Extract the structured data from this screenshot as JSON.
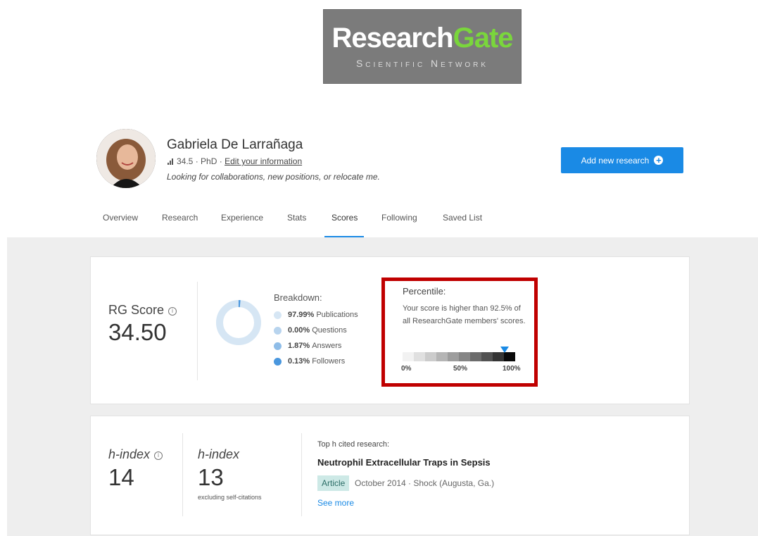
{
  "logo": {
    "word1": "Research",
    "word2": "Gate",
    "subtitle": "Scientific Network"
  },
  "profile": {
    "name": "Gabriela De Larrañaga",
    "score": "34.5",
    "degree": "· PhD ·",
    "edit_link": "Edit your information",
    "tagline": "Looking for collaborations, new positions, or relocate me."
  },
  "actions": {
    "add_research": "Add new research"
  },
  "tabs": [
    {
      "label": "Overview"
    },
    {
      "label": "Research"
    },
    {
      "label": "Experience"
    },
    {
      "label": "Stats"
    },
    {
      "label": "Scores",
      "active": true
    },
    {
      "label": "Following"
    },
    {
      "label": "Saved List"
    }
  ],
  "rg_score": {
    "label": "RG Score",
    "value": "34.50",
    "breakdown_label": "Breakdown:",
    "breakdown": [
      {
        "pct": "97.99%",
        "label": "Publications",
        "color": "#d6e6f4"
      },
      {
        "pct": "0.00%",
        "label": "Questions",
        "color": "#b8d4ee"
      },
      {
        "pct": "1.87%",
        "label": "Answers",
        "color": "#8fbde8"
      },
      {
        "pct": "0.13%",
        "label": "Followers",
        "color": "#4a97de"
      }
    ],
    "percentile": {
      "label": "Percentile:",
      "text": "Your score is higher than 92.5% of all ResearchGate members' scores.",
      "value": 92.5,
      "scale": [
        "0%",
        "50%",
        "100%"
      ]
    }
  },
  "h_index": {
    "label": "h-index",
    "value": "14",
    "excl_label": "h-index",
    "excl_value": "13",
    "excl_note": "excluding self-citations",
    "top_label": "Top h cited research:",
    "paper_title": "Neutrophil Extracellular Traps in Sepsis",
    "paper_type": "Article",
    "paper_meta": "October 2014 · Shock (Augusta, Ga.)",
    "see_more": "See more"
  },
  "colors": {
    "accent": "#1a8ae5",
    "highlight_box": "#c00000",
    "badge_bg": "#cde9e6"
  }
}
